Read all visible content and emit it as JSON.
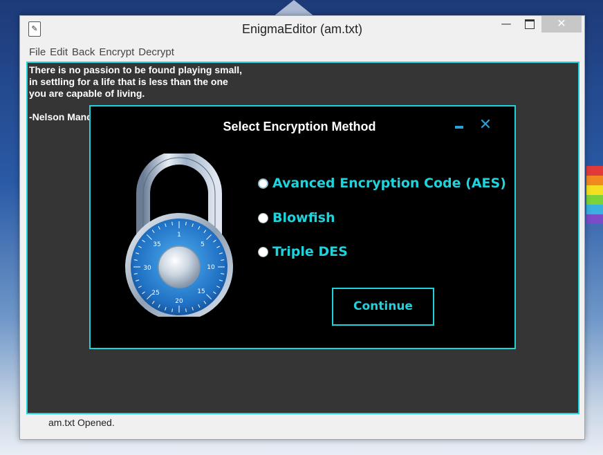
{
  "window": {
    "title": "EnigmaEditor (am.txt)",
    "controls": {
      "minimize": "—",
      "close": "✕"
    }
  },
  "menu": [
    "File",
    "Edit",
    "Back",
    "Encrypt",
    "Decrypt"
  ],
  "editor": {
    "text": "There is no passion to be found playing small,\nin settling for a life that is less than the one\nyou are capable of living.\n\n-Nelson Mandela"
  },
  "status": "am.txt Opened.",
  "dialog": {
    "title": "Select Encryption Method",
    "minimize": "–",
    "close": "✕",
    "options": [
      {
        "label": "Avanced Encryption Code (AES)",
        "selected": true
      },
      {
        "label": "Blowfish",
        "selected": false
      },
      {
        "label": "Triple DES",
        "selected": false
      }
    ],
    "continue_label": "Continue",
    "dial_numbers": [
      "1",
      "5",
      "10",
      "15",
      "20",
      "25",
      "30",
      "35"
    ]
  },
  "colors": {
    "accent": "#1ed3dc",
    "dialog_bg": "#000000",
    "editor_bg": "#353535"
  }
}
